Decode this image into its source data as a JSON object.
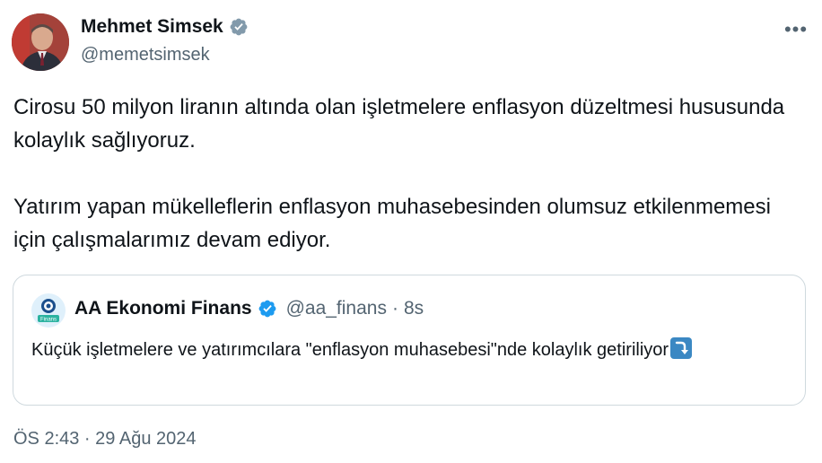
{
  "author": {
    "name": "Mehmet Simsek",
    "handle": "@memetsimsek",
    "verified_color": "#829aab"
  },
  "more_label": "•••",
  "tweet": {
    "paragraph_1": "Cirosu 50 milyon liranın altında olan işletmelere enflasyon düzeltmesi hususunda kolaylık sağlıyoruz.",
    "paragraph_2": "Yatırım yapan mükelleflerin enflasyon muhasebesinden olumsuz etkilenmemesi için çalışmalarımız devam ediyor."
  },
  "quote": {
    "name": "AA Ekonomi Finans",
    "handle": "@aa_finans",
    "separator": "·",
    "time": "8s",
    "text": "Küçük işletmelere ve yatırımcılara \"enflasyon muhasebesi\"nde kolaylık getiriliyor",
    "emoji": "arrow-curving-down-icon",
    "verified_color": "#1d9bf0",
    "avatar_logo_text": "Finans"
  },
  "timestamp": "ÖS 2:43 · 29 Ağu 2024"
}
